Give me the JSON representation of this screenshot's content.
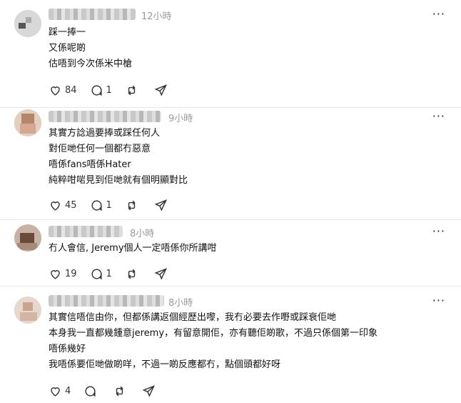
{
  "posts": [
    {
      "username": "ashssuanlioying",
      "time": "12小時",
      "lines": [
        "踩一捧一",
        "又係呢啲",
        "估唔到今次係米中槍"
      ],
      "likes": "84",
      "replies": "1"
    },
    {
      "username": "b",
      "username_tail": "e",
      "time": "9小時",
      "lines": [
        "其實方諗過要捧或踩任何人",
        "對佢哋任何一個都冇惡意",
        "唔係fans唔係Hater",
        "純粹咁啱見到佢哋就有個明顯對比"
      ],
      "likes": "45",
      "replies": "1"
    },
    {
      "username": "artemis_shook",
      "username_tail": "k",
      "time": "8小時",
      "lines": [
        "冇人會信, Jeremy個人一定唔係你所講咁"
      ],
      "likes": "19",
      "replies": "1"
    },
    {
      "username": "",
      "time": "8小時",
      "lines": [
        "其實信唔信由你，但都係講返個經歷出嚟，我冇必要去作嘢或踩衰佢哋",
        "本身我一直都幾鍾意jeremy，有留意開佢，亦有聽佢啲歌，不過只係個第一印象",
        "唔係幾好",
        "我唔係要佢哋做啲咩，不過一啲反應都冇，點個頭都好呀"
      ],
      "likes": "4",
      "replies": ""
    }
  ],
  "icons": {
    "like": "heart-icon",
    "reply": "comment-icon",
    "repost": "repost-icon",
    "share": "share-icon",
    "more": "more-icon"
  }
}
